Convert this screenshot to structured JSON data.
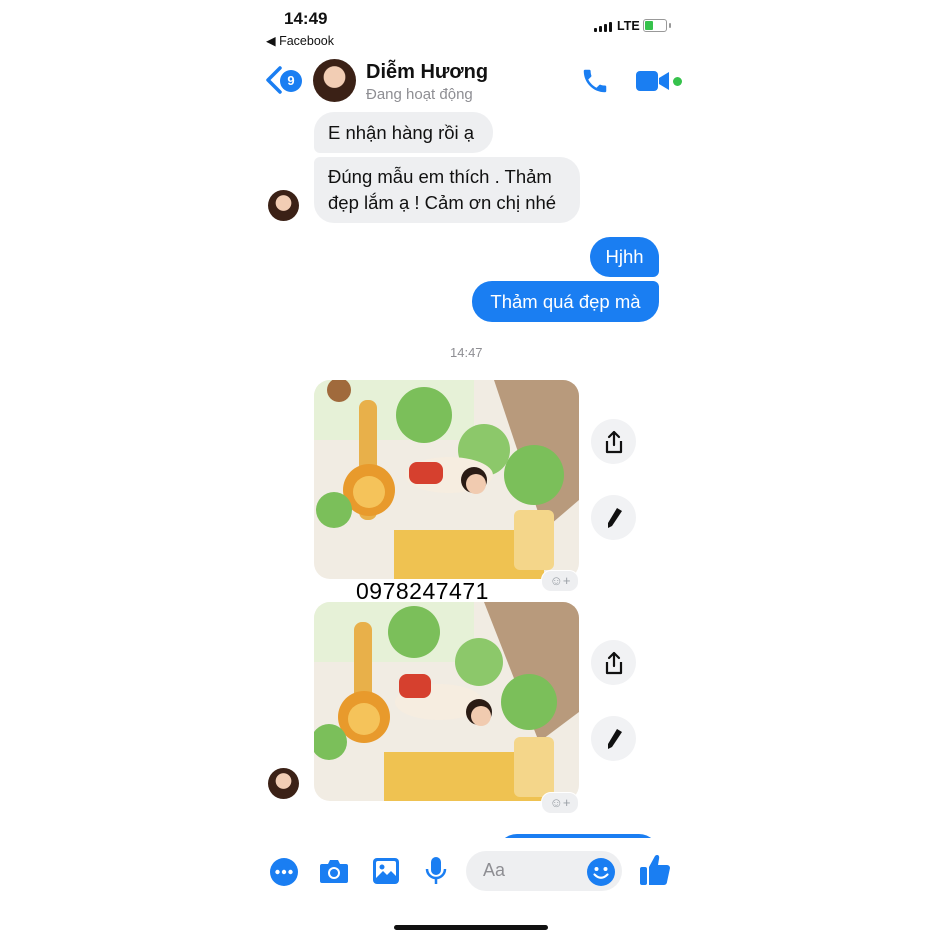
{
  "status_bar": {
    "time": "14:49",
    "back_app": "◀ Facebook",
    "network": "LTE"
  },
  "header": {
    "unread_count": "9",
    "contact_name": "Diễm Hương",
    "contact_status": "Đang hoạt động"
  },
  "messages": [
    {
      "direction": "in",
      "text": "E nhận hàng rồi ạ"
    },
    {
      "direction": "in",
      "text_line1": "Đúng mẫu em thích . Thảm",
      "text_line2": "đẹp lắm ạ ! Cảm ơn chị nhé"
    },
    {
      "direction": "out",
      "text": "Hjhh"
    },
    {
      "direction": "out",
      "text": "Thảm quá đẹp mà"
    }
  ],
  "timestamp": "14:47",
  "overlay_phone": "0978247471",
  "composer": {
    "placeholder": "Aa"
  },
  "icons": [
    "back-chevron-icon",
    "phone-call-icon",
    "video-call-icon",
    "share-icon",
    "edit-pen-icon",
    "more-icon",
    "camera-icon",
    "gallery-icon",
    "microphone-icon",
    "emoji-icon",
    "thumbs-up-icon",
    "add-reaction-icon"
  ],
  "colors": {
    "messenger_blue": "#1a7ef2",
    "incoming_bubble": "#eeeff1",
    "online_green": "#36c24c"
  }
}
